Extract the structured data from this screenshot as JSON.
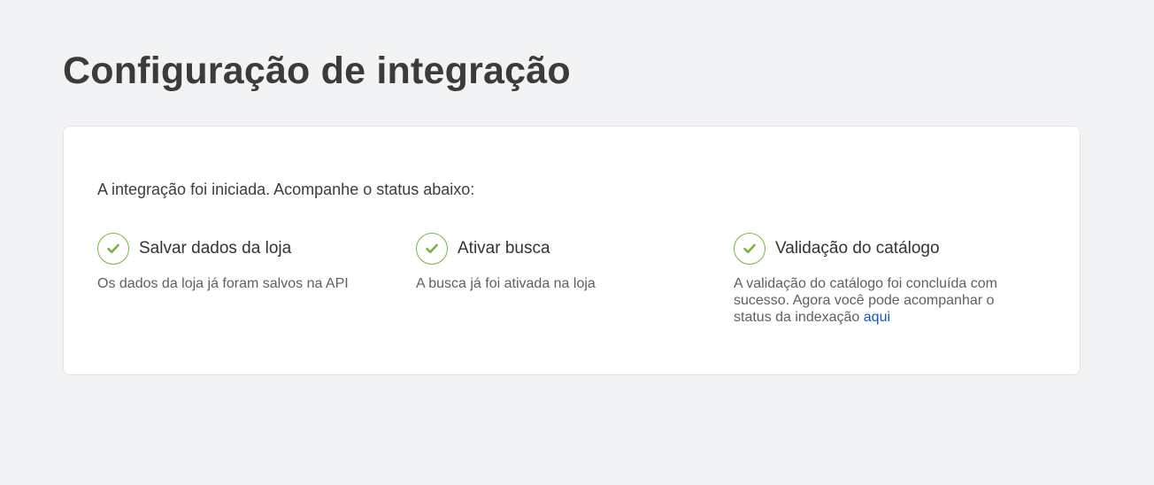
{
  "page": {
    "title": "Configuração de integração"
  },
  "card": {
    "intro": "A integração foi iniciada. Acompanhe o status abaixo:",
    "steps": [
      {
        "status": "complete",
        "icon": "check-circle-icon",
        "title": "Salvar dados da loja",
        "description": "Os dados da loja já foram salvos na API"
      },
      {
        "status": "complete",
        "icon": "check-circle-icon",
        "title": "Ativar busca",
        "description": "A busca já foi ativada na loja"
      },
      {
        "status": "complete",
        "icon": "check-circle-icon",
        "title": "Validação do catálogo",
        "description": "A validação do catálogo foi concluída com sucesso. Agora você pode acompanhar o status da indexação",
        "link_label": "aqui"
      }
    ]
  },
  "colors": {
    "background": "#f2f3f5",
    "card": "#ffffff",
    "success": "#7cb342",
    "link": "#1a56c4"
  }
}
